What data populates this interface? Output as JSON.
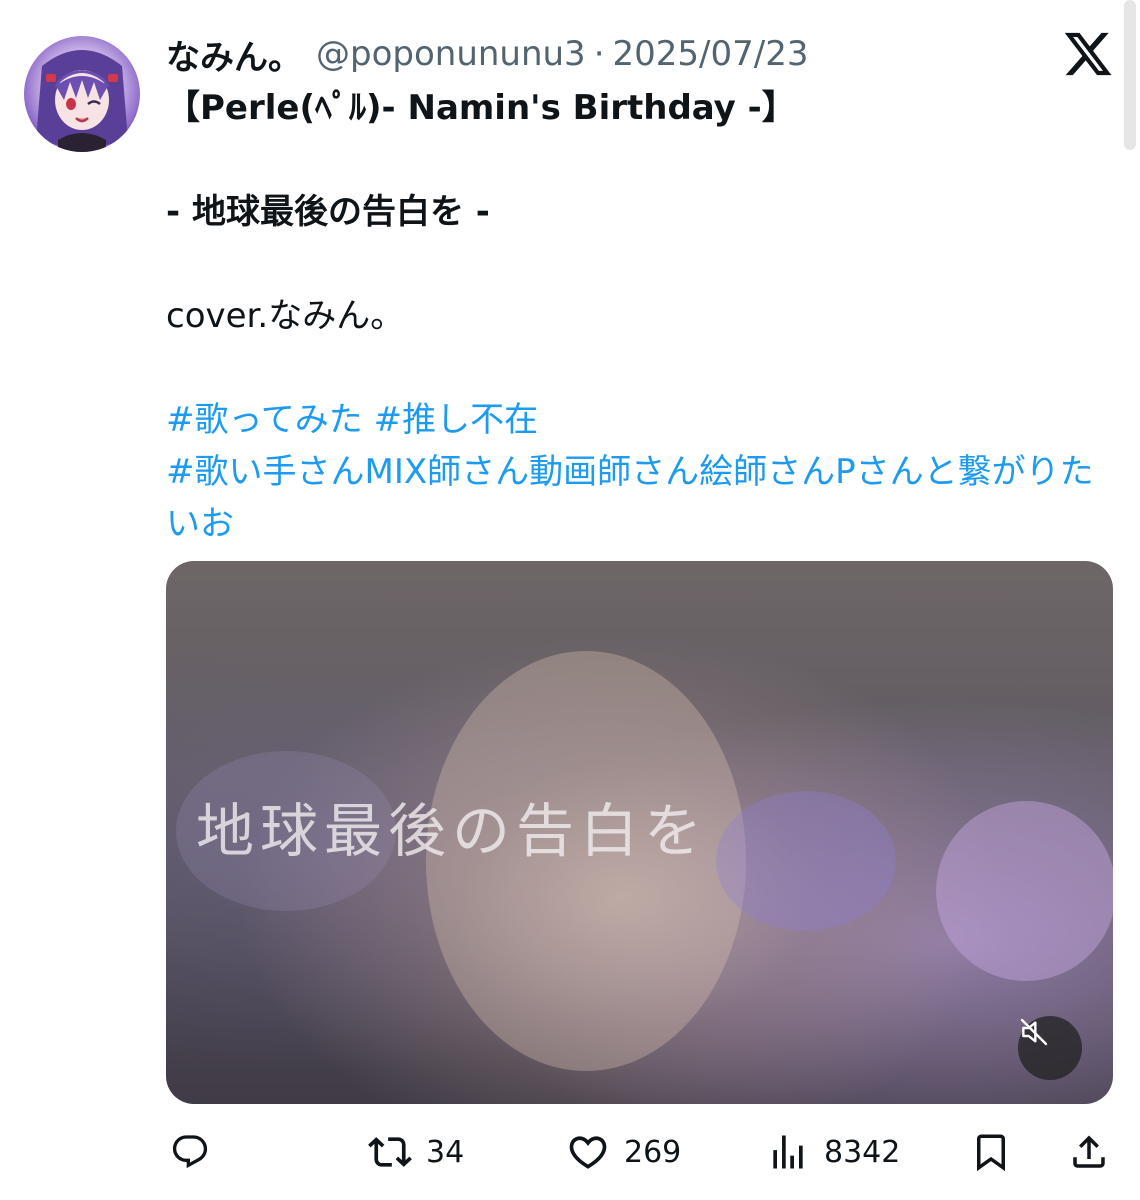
{
  "tweet": {
    "display_name": "なみん。",
    "handle": "@poponununu3",
    "separator": "·",
    "date": "2025/07/23",
    "lines": [
      "【Perle(ﾍﾟﾙ)- Namin's Birthday -】",
      "-  地球最後の告白を -",
      "cover.なみん。"
    ],
    "hashtags_line1": "#歌ってみた #推し不在",
    "hashtags_line2": "#歌い手さんMIX師さん動画師さん絵師さんPさんと繋がりたいお"
  },
  "media": {
    "overlay_text": "地球最後の告白を",
    "mute_icon": "muted-speaker-icon"
  },
  "actions": {
    "reply_icon": "reply-icon",
    "retweet_icon": "retweet-icon",
    "retweet_count": "34",
    "like_icon": "heart-icon",
    "like_count": "269",
    "views_icon": "views-icon",
    "views_count": "8342",
    "bookmark_icon": "bookmark-icon",
    "share_icon": "share-icon"
  },
  "colors": {
    "text": "#0f1419",
    "secondary": "#536471",
    "link": "#1d9bf0"
  }
}
